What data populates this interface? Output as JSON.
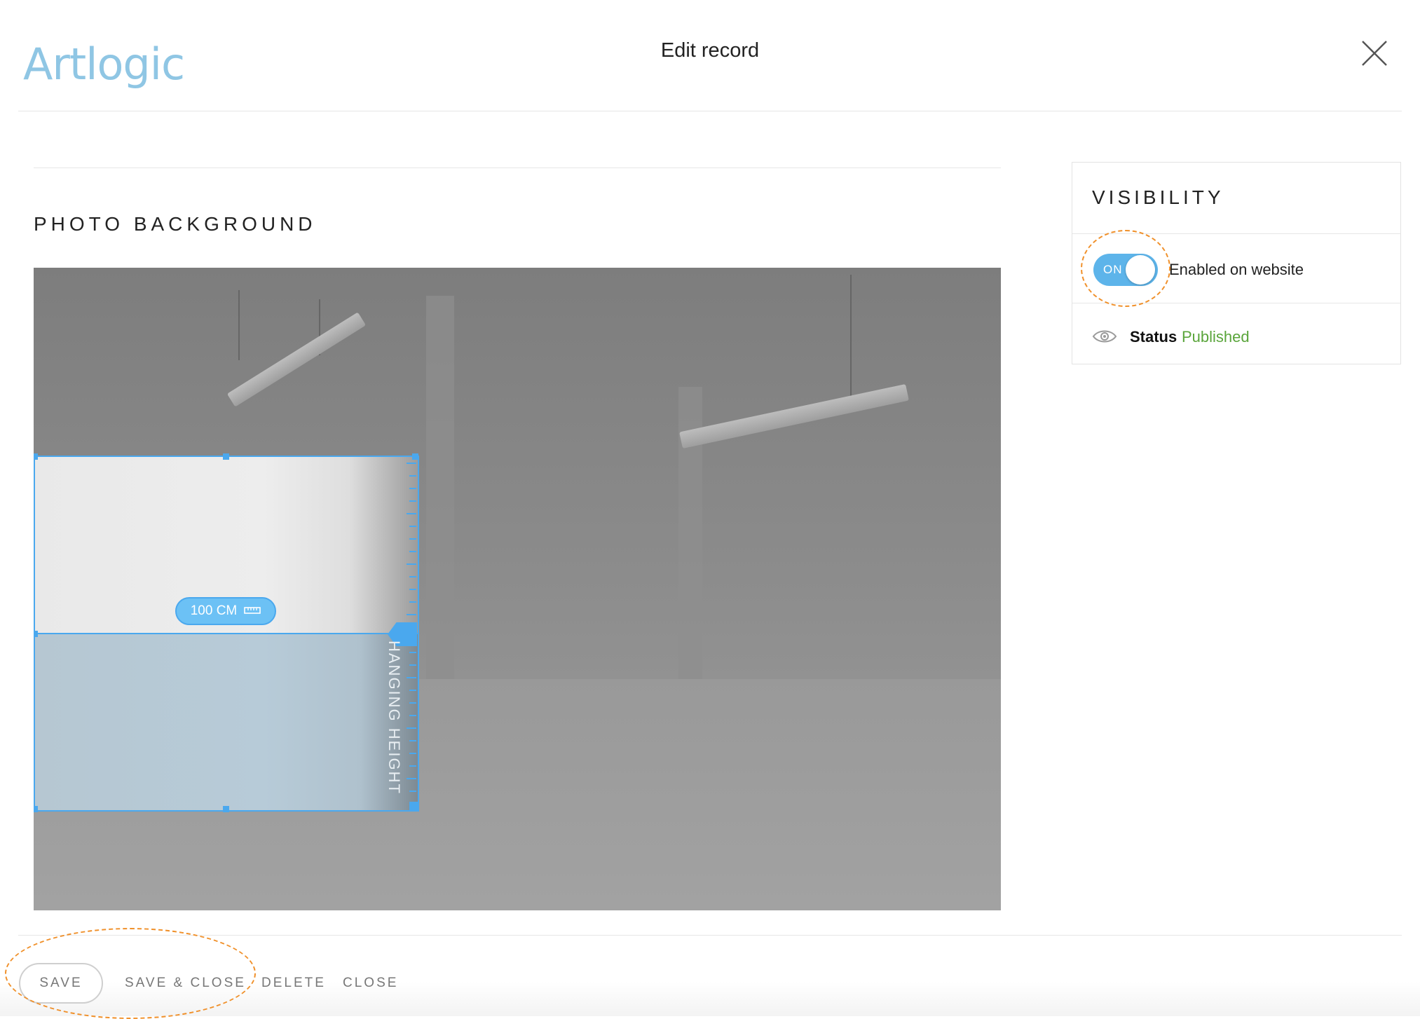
{
  "header": {
    "logo": "Artlogic",
    "title": "Edit record",
    "close_icon": "close-icon"
  },
  "main": {
    "section_title": "PHOTO BACKGROUND",
    "photo": {
      "width_label": "100 CM",
      "height_label": "HANGING HEIGHT"
    }
  },
  "visibility": {
    "title": "VISIBILITY",
    "toggle_label": "ON",
    "toggle_state": true,
    "enabled_text": "Enabled on website",
    "status_label": "Status",
    "status_value": "Published"
  },
  "footer": {
    "save": "SAVE",
    "save_close": "SAVE & CLOSE",
    "delete": "DELETE",
    "close": "CLOSE"
  },
  "colors": {
    "accent": "#4aa8ee",
    "logo": "#8fc6e4",
    "published": "#5aa53b",
    "annotation": "#f0902a"
  }
}
